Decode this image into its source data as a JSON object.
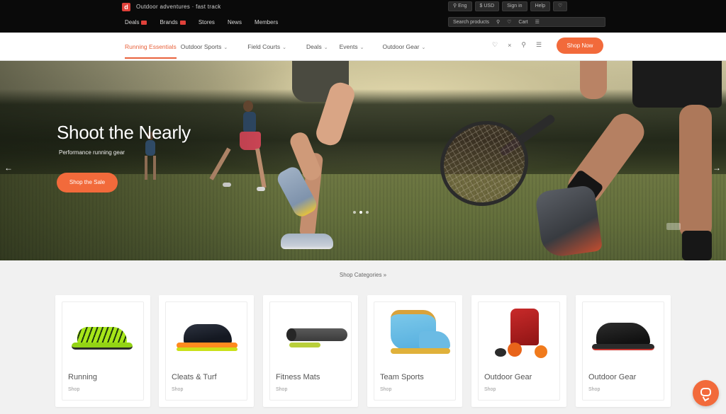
{
  "topbar": {
    "logo_mark": "d",
    "tagline": "Outdoor adventures · fast track",
    "links": [
      {
        "label": "Deals",
        "badge": true
      },
      {
        "label": "Brands",
        "badge": true
      },
      {
        "label": "Stores",
        "badge": false
      },
      {
        "label": "News",
        "badge": false
      },
      {
        "label": "Members",
        "badge": false
      }
    ],
    "util_row1": [
      "⚲ Eng",
      "$ USD",
      "Sign in",
      "Help",
      "♡"
    ],
    "util_row2": [
      "Search products",
      "⚲",
      "♡",
      "Cart",
      "☰"
    ]
  },
  "navbar": {
    "links": [
      {
        "label": "Running Essentials",
        "active": true,
        "chevron": false
      },
      {
        "label": "Outdoor Sports",
        "active": false,
        "chevron": true
      },
      {
        "label": "Field Courts",
        "active": false,
        "chevron": true
      },
      {
        "label": "Deals",
        "active": false,
        "chevron": true
      },
      {
        "label": "Events",
        "active": false,
        "chevron": true
      },
      {
        "label": "Outdoor Gear",
        "active": false,
        "chevron": true
      }
    ],
    "icons": [
      "♡",
      "×",
      "⚲",
      "☰"
    ],
    "cta_label": "Shop Now"
  },
  "hero": {
    "headline": "Shoot the Nearly",
    "subheadline": "Performance running gear",
    "button_label": "Shop the Sale",
    "prev_arrow": "←",
    "next_arrow": "→",
    "slides": 3,
    "active_slide": 2
  },
  "section": {
    "title": "Shop Categories »"
  },
  "categories": [
    {
      "name": "Running",
      "meta": "Shop"
    },
    {
      "name": "Cleats & Turf",
      "meta": "Shop"
    },
    {
      "name": "Fitness Mats",
      "meta": "Shop"
    },
    {
      "name": "Team Sports",
      "meta": "Shop"
    },
    {
      "name": "Outdoor Gear",
      "meta": "Shop"
    },
    {
      "name": "Outdoor Gear",
      "meta": "Shop"
    }
  ],
  "colors": {
    "accent": "#f26a3b",
    "topbar_bg": "#0a0a0a"
  }
}
